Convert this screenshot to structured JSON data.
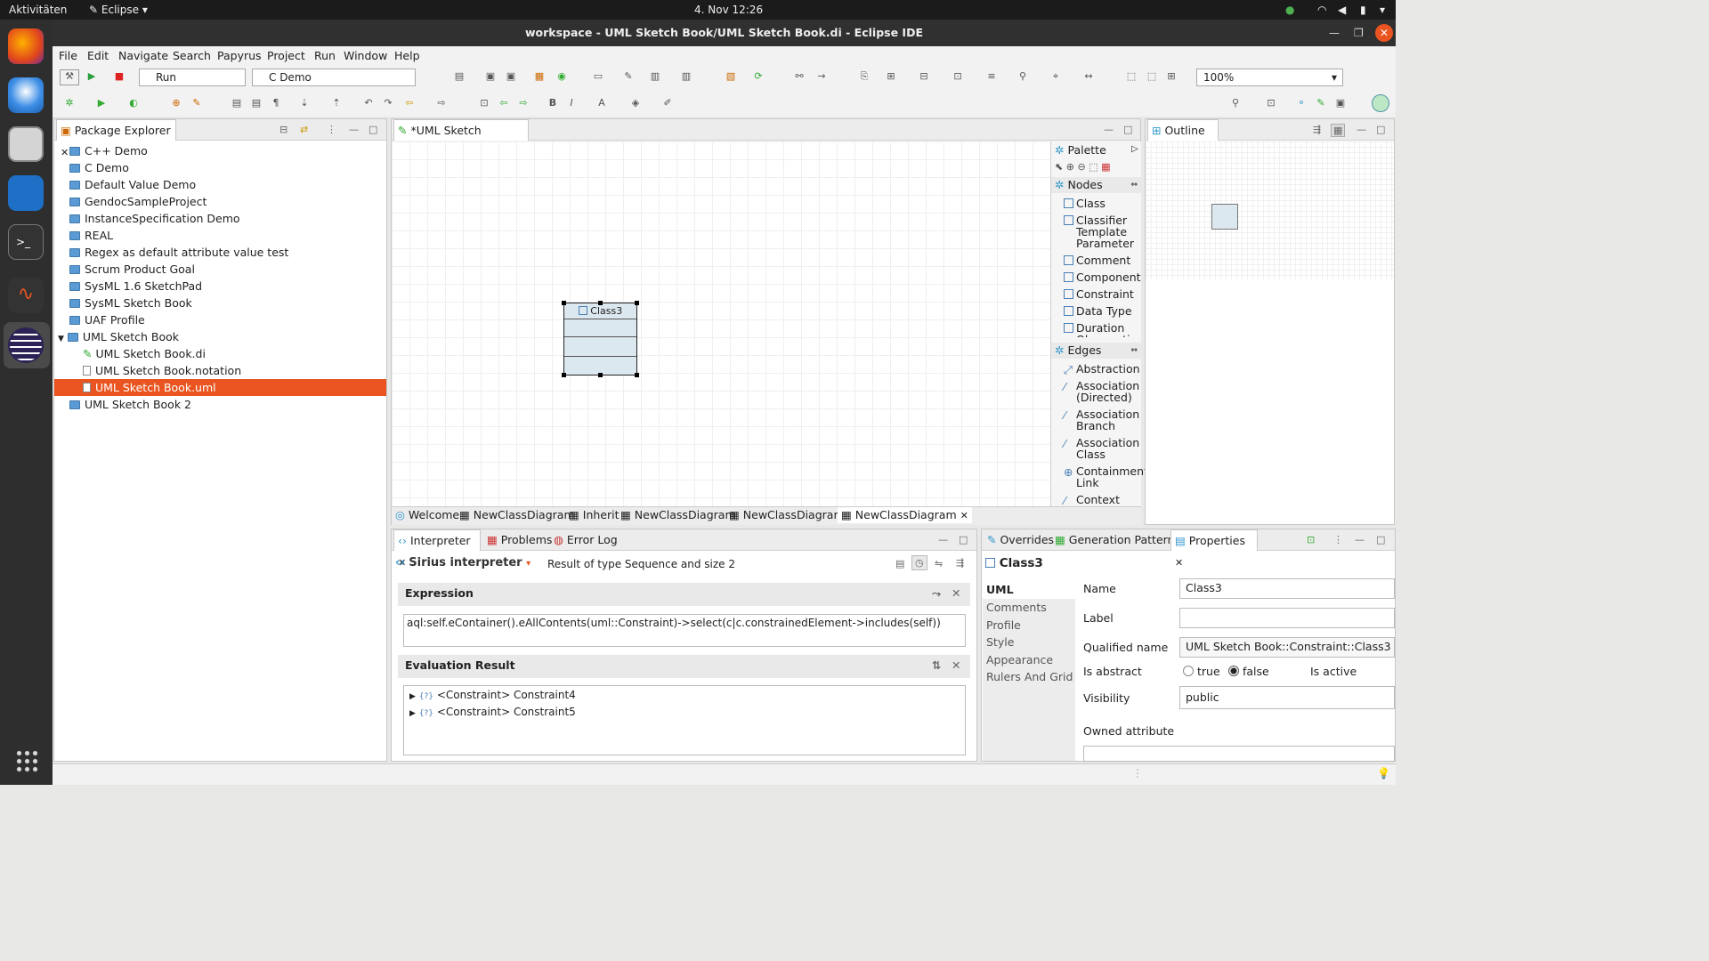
{
  "topbar": {
    "activities": "Aktivitäten",
    "app": "Eclipse",
    "clock": "4. Nov  12:26"
  },
  "window": {
    "title": "workspace - UML Sketch Book/UML Sketch Book.di - Eclipse IDE"
  },
  "menu": [
    "File",
    "Edit",
    "Navigate",
    "Search",
    "Papyrus",
    "Project",
    "Run",
    "Window",
    "Help"
  ],
  "toolbar": {
    "run_combo": "Run",
    "launch_combo": "C Demo",
    "zoom": "100%"
  },
  "package_explorer": {
    "title": "Package Explorer",
    "items": [
      {
        "label": "C++ Demo",
        "kind": "project",
        "depth": 0
      },
      {
        "label": "C Demo",
        "kind": "project",
        "depth": 0
      },
      {
        "label": "Default Value Demo",
        "kind": "project",
        "depth": 0
      },
      {
        "label": "GendocSampleProject",
        "kind": "project",
        "depth": 0
      },
      {
        "label": "InstanceSpecification Demo",
        "kind": "project",
        "depth": 0
      },
      {
        "label": "REAL",
        "kind": "project",
        "depth": 0
      },
      {
        "label": "Regex as default attribute value test",
        "kind": "project",
        "depth": 0
      },
      {
        "label": "Scrum Product Goal",
        "kind": "project",
        "depth": 0
      },
      {
        "label": "SysML 1.6 SketchPad",
        "kind": "project",
        "depth": 0
      },
      {
        "label": "SysML Sketch Book",
        "kind": "project",
        "depth": 0
      },
      {
        "label": "UAF Profile",
        "kind": "project",
        "depth": 0
      },
      {
        "label": "UML Sketch Book",
        "kind": "project-open",
        "depth": 0
      },
      {
        "label": "UML Sketch Book.di",
        "kind": "file",
        "depth": 1
      },
      {
        "label": "UML Sketch Book.notation",
        "kind": "file",
        "depth": 1
      },
      {
        "label": "UML Sketch Book.uml",
        "kind": "file",
        "depth": 1,
        "selected": true
      },
      {
        "label": "UML Sketch Book 2",
        "kind": "project",
        "depth": 0
      }
    ]
  },
  "editor": {
    "tab": "*UML Sketch Book.di",
    "class_node": "Class3",
    "bottom_tabs": [
      "Welcome",
      "NewClassDiagram",
      "Inherit",
      "NewClassDiagram",
      "NewClassDiagram",
      "NewClassDiagram"
    ]
  },
  "palette": {
    "title": "Palette",
    "nodes_title": "Nodes",
    "nodes": [
      {
        "label": "Class",
        "lines": 1
      },
      {
        "label": "Classifier Template Parameter",
        "lines": 3
      },
      {
        "label": "Comment",
        "lines": 1
      },
      {
        "label": "Component",
        "lines": 1
      },
      {
        "label": "Constraint",
        "lines": 1
      },
      {
        "label": "Data Type",
        "lines": 1
      },
      {
        "label": "Duration Observation",
        "lines": 1
      }
    ],
    "edges_title": "Edges",
    "edges": [
      {
        "label": "Abstraction",
        "lines": 1
      },
      {
        "label": "Association (Directed)",
        "lines": 2
      },
      {
        "label": "Association Branch",
        "lines": 2
      },
      {
        "label": "Association Class",
        "lines": 2
      },
      {
        "label": "Containment Link",
        "lines": 2
      },
      {
        "label": "Context Link",
        "lines": 1
      }
    ]
  },
  "outline": {
    "title": "Outline"
  },
  "interpreter": {
    "tabs": [
      "Interpreter",
      "Problems",
      "Error Log"
    ],
    "name": "Sirius interpreter",
    "result_info": "Result of type Sequence and size 2",
    "expression_title": "Expression",
    "expression": "aql:self.eContainer().eAllContents(uml::Constraint)->select(c|c.constrainedElement->includes(self))",
    "result_title": "Evaluation Result",
    "results": [
      "<Constraint> Constraint4",
      "<Constraint> Constraint5"
    ]
  },
  "properties": {
    "tabs": [
      "Overrides",
      "Generation Patterns",
      "Properties"
    ],
    "element": "Class3",
    "categories": [
      "UML",
      "Comments",
      "Profile",
      "Style",
      "Appearance",
      "Rulers And Grid"
    ],
    "name_label": "Name",
    "name_value": "Class3",
    "label_label": "Label",
    "label_value": "",
    "qualified_label": "Qualified name",
    "qualified_value": "UML Sketch Book::Constraint::Class3",
    "abstract_label": "Is abstract",
    "true_label": "true",
    "false_label": "false",
    "active_label": "Is active",
    "visibility_label": "Visibility",
    "visibility_value": "public",
    "owned_label": "Owned attribute"
  },
  "colors": {
    "selection": "#e95420",
    "accent": "#2f6fb5"
  }
}
